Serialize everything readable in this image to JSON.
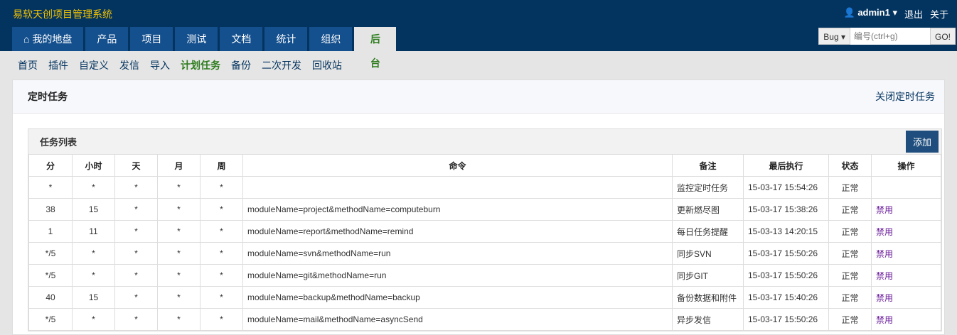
{
  "brand": "易软天创项目管理系统",
  "user": {
    "name": "admin1",
    "logout": "退出",
    "about": "关于"
  },
  "tabs": [
    "我的地盘",
    "产品",
    "项目",
    "测试",
    "文档",
    "统计",
    "组织",
    "后台"
  ],
  "search": {
    "type": "Bug",
    "placeholder": "编号(ctrl+g)",
    "go": "GO!"
  },
  "subnav": [
    "首页",
    "插件",
    "自定义",
    "发信",
    "导入",
    "计划任务",
    "备份",
    "二次开发",
    "回收站"
  ],
  "panel": {
    "title": "定时任务",
    "close": "关闭定时任务",
    "list_title": "任务列表",
    "add": "添加"
  },
  "headers": [
    "分",
    "小时",
    "天",
    "月",
    "周",
    "命令",
    "备注",
    "最后执行",
    "状态",
    "操作"
  ],
  "rows": [
    [
      "*",
      "*",
      "*",
      "*",
      "*",
      "",
      "监控定时任务",
      "15-03-17 15:54:26",
      "正常",
      ""
    ],
    [
      "38",
      "15",
      "*",
      "*",
      "*",
      "moduleName=project&methodName=computeburn",
      "更新燃尽图",
      "15-03-17 15:38:26",
      "正常",
      "禁用"
    ],
    [
      "1",
      "11",
      "*",
      "*",
      "*",
      "moduleName=report&methodName=remind",
      "每日任务提醒",
      "15-03-13 14:20:15",
      "正常",
      "禁用"
    ],
    [
      "*/5",
      "*",
      "*",
      "*",
      "*",
      "moduleName=svn&methodName=run",
      "同步SVN",
      "15-03-17 15:50:26",
      "正常",
      "禁用"
    ],
    [
      "*/5",
      "*",
      "*",
      "*",
      "*",
      "moduleName=git&methodName=run",
      "同步GIT",
      "15-03-17 15:50:26",
      "正常",
      "禁用"
    ],
    [
      "40",
      "15",
      "*",
      "*",
      "*",
      "moduleName=backup&methodName=backup",
      "备份数据和附件",
      "15-03-17 15:40:26",
      "正常",
      "禁用"
    ],
    [
      "*/5",
      "*",
      "*",
      "*",
      "*",
      "moduleName=mail&methodName=asyncSend",
      "异步发信",
      "15-03-17 15:50:26",
      "正常",
      "禁用"
    ]
  ]
}
